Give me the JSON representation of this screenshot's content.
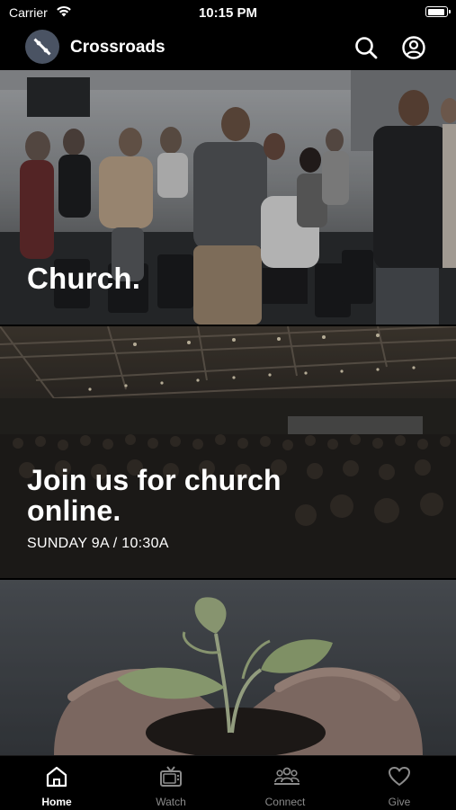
{
  "status": {
    "carrier": "Carrier",
    "time": "10:15 PM",
    "battery_level": 0.95
  },
  "header": {
    "title": "Crossroads",
    "logo_icon": "crossroads-logo-icon",
    "search_icon": "search-icon",
    "account_icon": "user-circle-icon"
  },
  "feed": {
    "cards": [
      {
        "title": "Church."
      },
      {
        "title": "Join us for church online.",
        "subtitle": "SUNDAY 9A / 10:30A"
      },
      {
        "title": ""
      }
    ]
  },
  "tabs": [
    {
      "label": "Home",
      "icon": "home-icon",
      "active": true
    },
    {
      "label": "Watch",
      "icon": "tv-icon",
      "active": false
    },
    {
      "label": "Connect",
      "icon": "people-icon",
      "active": false
    },
    {
      "label": "Give",
      "icon": "heart-icon",
      "active": false
    }
  ],
  "colors": {
    "background": "#000000",
    "logo_bg": "#4a5363",
    "active_tab": "#ffffff",
    "inactive_tab": "#8b8b8b"
  }
}
